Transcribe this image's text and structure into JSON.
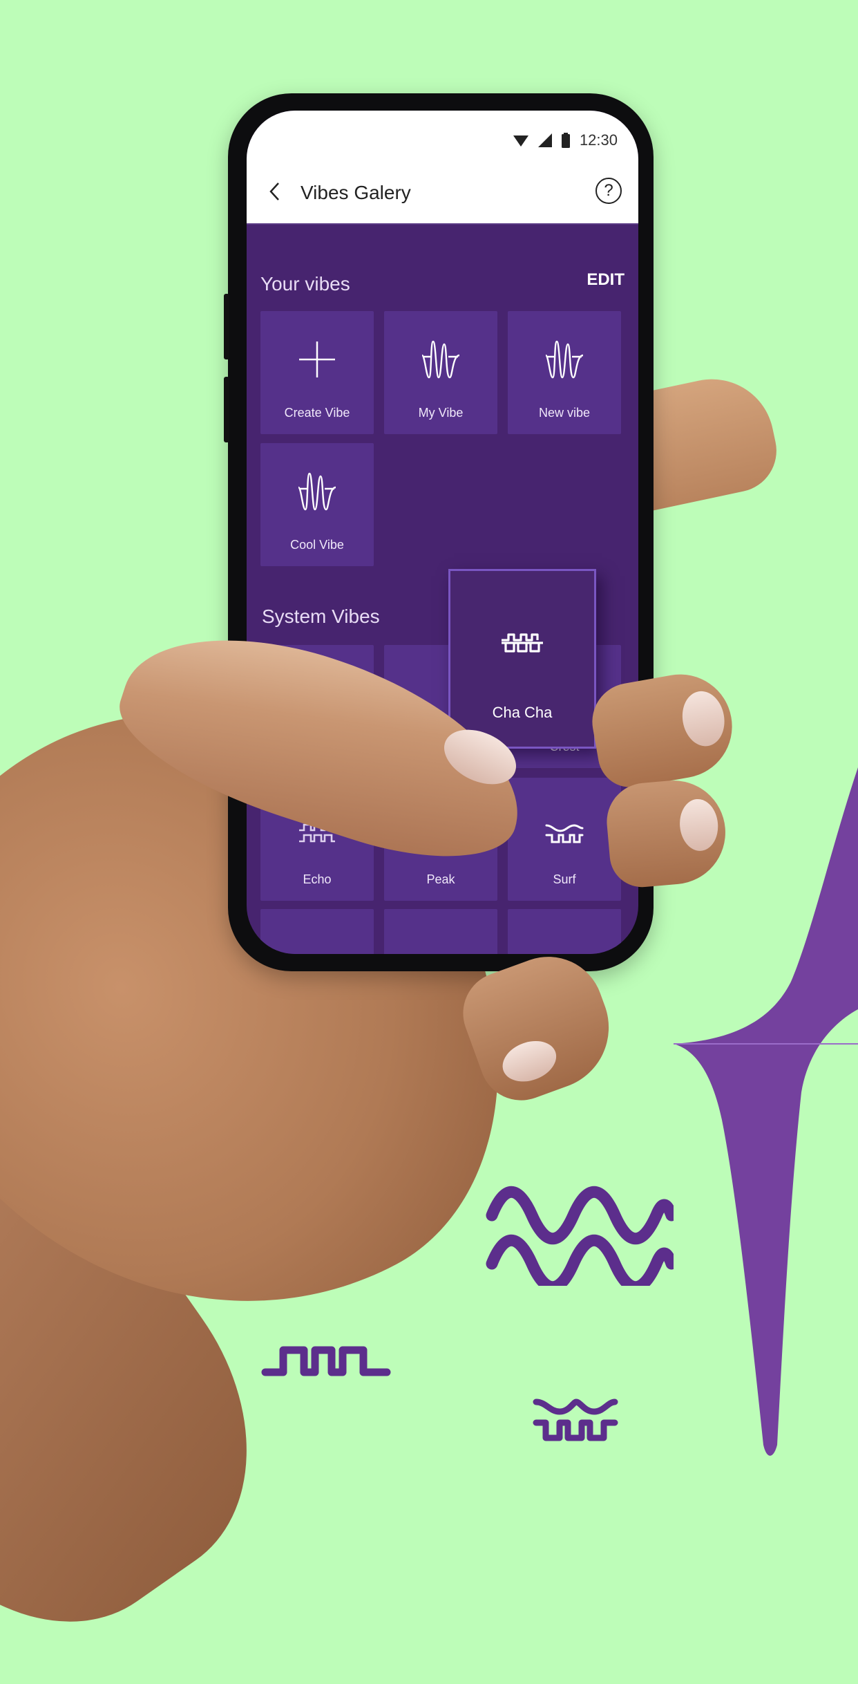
{
  "colors": {
    "background": "#bdfdb8",
    "brand_purple": "#47246f",
    "tile_purple": "#55318a",
    "drag_border": "#7a56c2",
    "deco_purple": "#5c2e8c",
    "spike_purple": "#74419e"
  },
  "status_bar": {
    "time": "12:30",
    "icons": [
      "wifi-icon",
      "cellular-signal-icon",
      "battery-icon"
    ]
  },
  "app_bar": {
    "title": "Vibes Galery",
    "back_icon": "chevron-left-icon",
    "help_icon": "help-circle-icon",
    "help_glyph": "?"
  },
  "your_vibes": {
    "title": "Your vibes",
    "edit_label": "EDIT",
    "items": [
      {
        "label": "Create Vibe",
        "icon": "plus-icon"
      },
      {
        "label": "My Vibe",
        "icon": "custom-waveform-icon"
      },
      {
        "label": "New vibe",
        "icon": "custom-waveform-icon"
      },
      {
        "label": "Cool Vibe",
        "icon": "custom-waveform-icon"
      }
    ]
  },
  "system_vibes": {
    "title": "System Vibes",
    "items": [
      {
        "label": "",
        "icon": "hidden-icon"
      },
      {
        "label": "",
        "icon": "hidden-icon"
      },
      {
        "label": "Crest",
        "icon": "crest-icon"
      },
      {
        "label": "Echo",
        "icon": "echo-square-wave-icon"
      },
      {
        "label": "Peak",
        "icon": "peak-pulse-icon"
      },
      {
        "label": "Surf",
        "icon": "surf-wave-icon"
      }
    ]
  },
  "dragged_vibe": {
    "label": "Cha Cha",
    "icon": "cha-cha-step-wave-icon"
  }
}
